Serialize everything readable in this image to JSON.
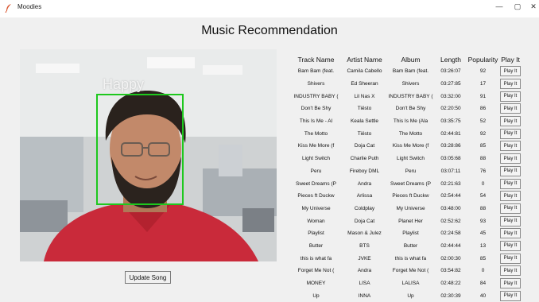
{
  "window": {
    "title": "Moodies"
  },
  "page": {
    "title": "Music Recommendation"
  },
  "camera": {
    "mood": "Happy",
    "alt": "webcam frame with detected face"
  },
  "update_button": "Update Song",
  "table": {
    "headers": [
      "Track Name",
      "Artist Name",
      "Album",
      "Length",
      "Popularity",
      "Play It"
    ],
    "rows": [
      {
        "track": "Bam Bam (feat.",
        "artist": "Camila Cabello",
        "album": "Bam Bam (feat.",
        "length": "03:26:07",
        "popularity": "92",
        "play": "Play It"
      },
      {
        "track": "Shivers",
        "artist": "Ed Sheeran",
        "album": "Shivers",
        "length": "03:27:85",
        "popularity": "17",
        "play": "Play It"
      },
      {
        "track": "INDUSTRY BABY (",
        "artist": "Lil Nas X",
        "album": "INDUSTRY BABY (",
        "length": "03:32:00",
        "popularity": "91",
        "play": "Play It"
      },
      {
        "track": "Don't Be Shy",
        "artist": "Tiësto",
        "album": "Don't Be Shy",
        "length": "02:20:50",
        "popularity": "86",
        "play": "Play It"
      },
      {
        "track": "This Is Me - Al",
        "artist": "Keala Settle",
        "album": "This Is Me (Ala",
        "length": "03:35:75",
        "popularity": "52",
        "play": "Play It"
      },
      {
        "track": "The Motto",
        "artist": "Tiësto",
        "album": "The Motto",
        "length": "02:44:81",
        "popularity": "92",
        "play": "Play It"
      },
      {
        "track": "Kiss Me More (f",
        "artist": "Doja Cat",
        "album": "Kiss Me More (f",
        "length": "03:28:86",
        "popularity": "85",
        "play": "Play It"
      },
      {
        "track": "Light Switch",
        "artist": "Charlie Puth",
        "album": "Light Switch",
        "length": "03:05:68",
        "popularity": "88",
        "play": "Play It"
      },
      {
        "track": "Peru",
        "artist": "Fireboy DML",
        "album": "Peru",
        "length": "03:07:11",
        "popularity": "76",
        "play": "Play It"
      },
      {
        "track": "Sweet Dreams (P",
        "artist": "Andra",
        "album": "Sweet Dreams (P",
        "length": "02:21:63",
        "popularity": "0",
        "play": "Play It"
      },
      {
        "track": "Pieces ft Duckw",
        "artist": "Arlissa",
        "album": "Pieces ft Duckw",
        "length": "02:54:44",
        "popularity": "54",
        "play": "Play It"
      },
      {
        "track": "My Universe",
        "artist": "Coldplay",
        "album": "My Universe",
        "length": "03:48:00",
        "popularity": "88",
        "play": "Play It"
      },
      {
        "track": "Woman",
        "artist": "Doja Cat",
        "album": "Planet Her",
        "length": "02:52:62",
        "popularity": "93",
        "play": "Play It"
      },
      {
        "track": "Playlist",
        "artist": "Mason & Julez",
        "album": "Playlist",
        "length": "02:24:58",
        "popularity": "45",
        "play": "Play It"
      },
      {
        "track": "Butter",
        "artist": "BTS",
        "album": "Butter",
        "length": "02:44:44",
        "popularity": "13",
        "play": "Play It"
      },
      {
        "track": "this is what fa",
        "artist": "JVKE",
        "album": "this is what fa",
        "length": "02:00:30",
        "popularity": "85",
        "play": "Play It"
      },
      {
        "track": "Forget Me Not (",
        "artist": "Andra",
        "album": "Forget Me Not (",
        "length": "03:54:82",
        "popularity": "0",
        "play": "Play It"
      },
      {
        "track": "MONEY",
        "artist": "LISA",
        "album": "LALISA",
        "length": "02:48:22",
        "popularity": "84",
        "play": "Play It"
      },
      {
        "track": "Up",
        "artist": "INNA",
        "album": "Up",
        "length": "02:30:39",
        "popularity": "40",
        "play": "Play It"
      }
    ]
  }
}
